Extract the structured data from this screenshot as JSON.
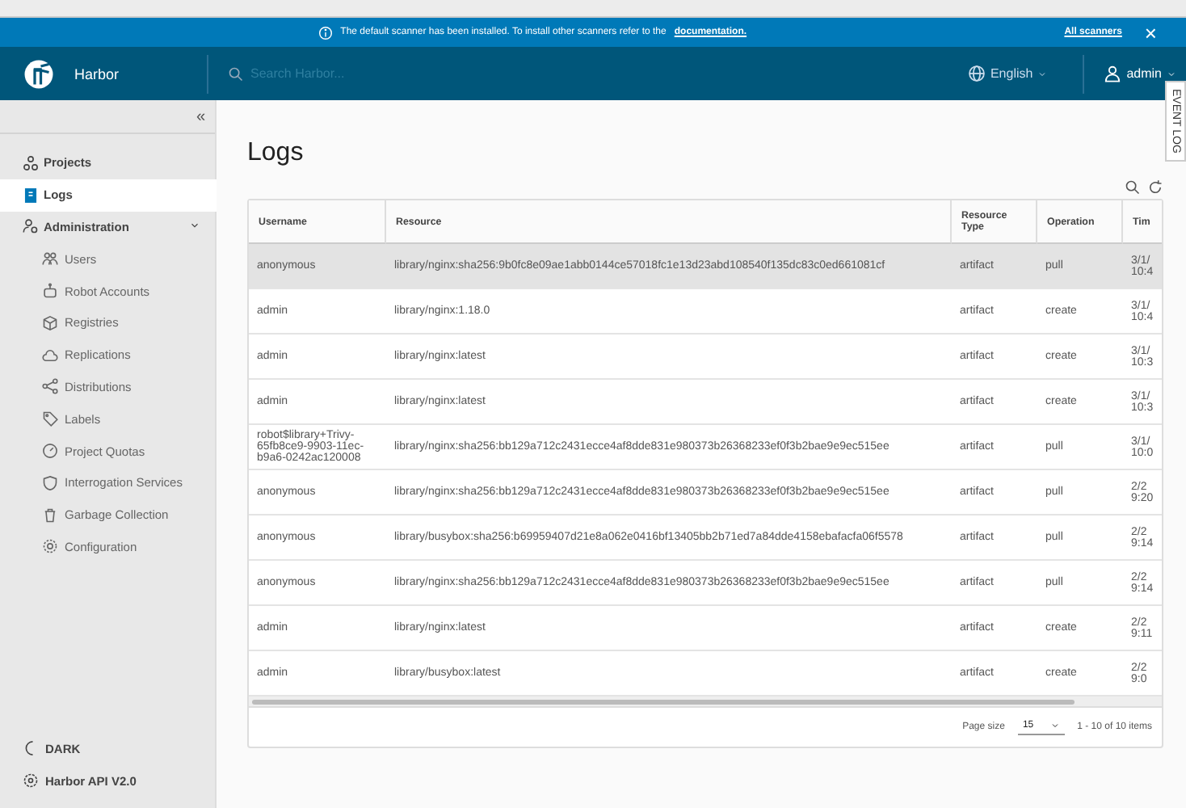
{
  "banner": {
    "message": "The default scanner has been installed. To install other scanners refer to the",
    "link": "documentation.",
    "action": "All scanners",
    "close": "×"
  },
  "header": {
    "brand": "Harbor",
    "search": {
      "placeholder": "Search Harbor..."
    },
    "language": "English",
    "user": "admin"
  },
  "event_log_tab": {
    "label": "EVENT LOG"
  },
  "sidebar": {
    "collapse": "«",
    "items": [
      {
        "label": "Projects",
        "selected": false
      },
      {
        "label": "Logs",
        "selected": true
      },
      {
        "label": "Administration",
        "selected": false,
        "expanded": true,
        "children": [
          {
            "label": "Users",
            "selected": false
          },
          {
            "label": "Robot Accounts",
            "selected": false
          },
          {
            "label": "Registries",
            "selected": false
          },
          {
            "label": "Replications",
            "selected": false
          },
          {
            "label": "Distributions",
            "selected": false
          },
          {
            "label": "Labels",
            "selected": false
          },
          {
            "label": "Project Quotas",
            "selected": false
          },
          {
            "label": "Interrogation Services",
            "selected": false
          },
          {
            "label": "Garbage Collection",
            "selected": false
          },
          {
            "label": "Configuration",
            "selected": false
          }
        ]
      }
    ],
    "footer": [
      {
        "label": "DARK"
      },
      {
        "label": "Harbor API V2.0"
      }
    ]
  },
  "page": {
    "title": "Logs"
  },
  "table": {
    "columns": [
      "Username",
      "Resource",
      "Resource Type",
      "Operation",
      "Tim"
    ],
    "rows": [
      {
        "selected": true,
        "cells": [
          "anonymous",
          "library/nginx:sha256:9b0fc8e09ae1abb0144ce57018fc1e13d23abd108540f135dc83c0ed661081cf",
          "artifact",
          "pull",
          "3/1/ 10:4"
        ]
      },
      {
        "selected": false,
        "cells": [
          "admin",
          "library/nginx:1.18.0",
          "artifact",
          "create",
          "3/1/ 10:4"
        ]
      },
      {
        "selected": false,
        "cells": [
          "admin",
          "library/nginx:latest",
          "artifact",
          "create",
          "3/1/ 10:3"
        ]
      },
      {
        "selected": false,
        "cells": [
          "admin",
          "library/nginx:latest",
          "artifact",
          "create",
          "3/1/ 10:3"
        ]
      },
      {
        "selected": false,
        "cells": [
          "robot$library+Trivy-65fb8ce9-9903-11ec-b9a6-0242ac120008",
          "library/nginx:sha256:bb129a712c2431ecce4af8dde831e980373b26368233ef0f3b2bae9e9ec515ee",
          "artifact",
          "pull",
          "3/1/ 10:0"
        ]
      },
      {
        "selected": false,
        "cells": [
          "anonymous",
          "library/nginx:sha256:bb129a712c2431ecce4af8dde831e980373b26368233ef0f3b2bae9e9ec515ee",
          "artifact",
          "pull",
          "2/2 9:20"
        ]
      },
      {
        "selected": false,
        "cells": [
          "anonymous",
          "library/busybox:sha256:b69959407d21e8a062e0416bf13405bb2b71ed7a84dde4158ebafacfa06f5578",
          "artifact",
          "pull",
          "2/2 9:14"
        ]
      },
      {
        "selected": false,
        "cells": [
          "anonymous",
          "library/nginx:sha256:bb129a712c2431ecce4af8dde831e980373b26368233ef0f3b2bae9e9ec515ee",
          "artifact",
          "pull",
          "2/2 9:14"
        ]
      },
      {
        "selected": false,
        "cells": [
          "admin",
          "library/nginx:latest",
          "artifact",
          "create",
          "2/2 9:11"
        ]
      },
      {
        "selected": false,
        "cells": [
          "admin",
          "library/busybox:latest",
          "artifact",
          "create",
          "2/2 9:0"
        ]
      }
    ],
    "footer": {
      "page_size_label": "Page size",
      "page_size": "15",
      "range": "1 - 10 of 10 items"
    }
  }
}
